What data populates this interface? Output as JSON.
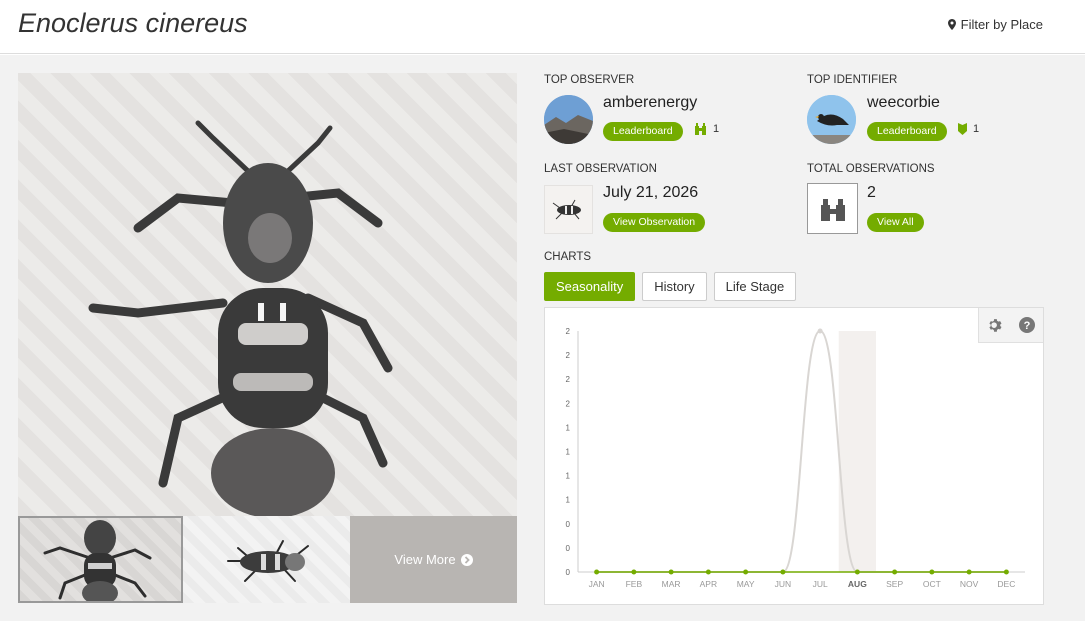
{
  "header": {
    "title": "Enoclerus cinereus",
    "filter_label": "Filter by Place"
  },
  "photos": {
    "view_more_label": "View More"
  },
  "top_observer": {
    "label": "TOP OBSERVER",
    "username": "amberenergy",
    "leaderboard_label": "Leaderboard",
    "count": "1"
  },
  "top_identifier": {
    "label": "TOP IDENTIFIER",
    "username": "weecorbie",
    "leaderboard_label": "Leaderboard",
    "count": "1"
  },
  "last_observation": {
    "label": "LAST OBSERVATION",
    "date": "July 21, 2026",
    "button_label": "View Observation"
  },
  "total_observations": {
    "label": "TOTAL OBSERVATIONS",
    "count": "2",
    "button_label": "View All"
  },
  "charts": {
    "label": "CHARTS",
    "tabs": [
      "Seasonality",
      "History",
      "Life Stage"
    ],
    "active_tab": "Seasonality"
  },
  "colors": {
    "accent": "#74ac00",
    "curve": "#d9d6d3",
    "highlight": "#f3f0ee"
  },
  "chart_data": {
    "type": "line",
    "categories": [
      "JAN",
      "FEB",
      "MAR",
      "APR",
      "MAY",
      "JUN",
      "JUL",
      "AUG",
      "SEP",
      "OCT",
      "NOV",
      "DEC"
    ],
    "highlight_category": "AUG",
    "y_tick_labels": [
      "0",
      "0",
      "0",
      "1",
      "1",
      "1",
      "1",
      "2",
      "2",
      "2",
      "2"
    ],
    "series": [
      {
        "values": [
          0,
          0,
          0,
          0,
          0,
          0,
          2,
          0,
          0,
          0,
          0,
          0
        ]
      }
    ],
    "ylim": [
      0,
      2
    ]
  }
}
